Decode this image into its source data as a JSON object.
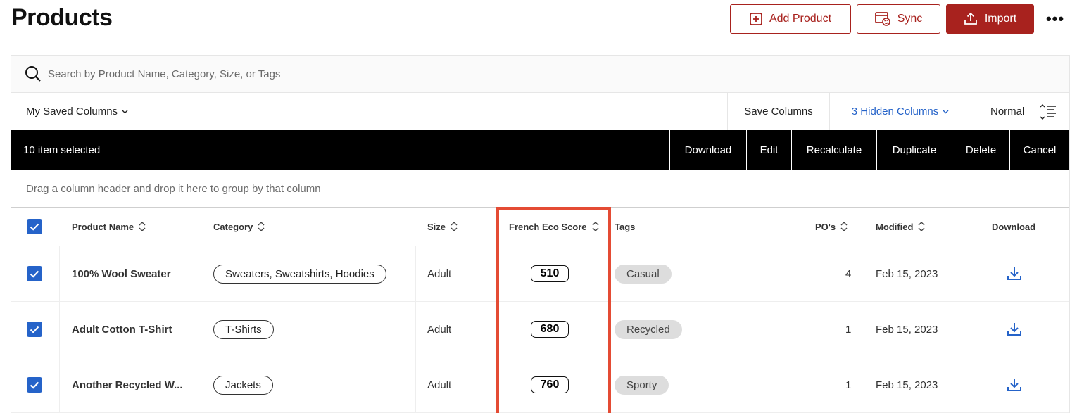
{
  "header": {
    "title": "Products",
    "add_product_label": "Add Product",
    "sync_label": "Sync",
    "import_label": "Import",
    "more_label": "•••"
  },
  "search": {
    "placeholder": "Search by Product Name, Category, Size, or Tags",
    "value": ""
  },
  "toolbar": {
    "saved_columns_label": "My Saved Columns",
    "save_columns_label": "Save Columns",
    "hidden_columns_label": "3 Hidden Columns",
    "density_label": "Normal"
  },
  "selection_bar": {
    "count_label": "10 item selected",
    "actions": [
      "Download",
      "Edit",
      "Recalculate",
      "Duplicate",
      "Delete",
      "Cancel"
    ]
  },
  "group_hint": "Drag a column header and drop it here to group by that column",
  "table": {
    "columns": [
      "Product Name",
      "Category",
      "Size",
      "French Eco Score",
      "Tags",
      "PO's",
      "Modified",
      "Download"
    ],
    "rows": [
      {
        "checked": true,
        "name": "100% Wool Sweater",
        "category": "Sweaters, Sweatshirts, Hoodies",
        "size": "Adult",
        "eco_score": "510",
        "tag": "Casual",
        "pos": "4",
        "modified": "Feb 15, 2023"
      },
      {
        "checked": true,
        "name": "Adult Cotton T-Shirt",
        "category": "T-Shirts",
        "size": "Adult",
        "eco_score": "680",
        "tag": "Recycled",
        "pos": "1",
        "modified": "Feb 15, 2023"
      },
      {
        "checked": true,
        "name": "Another Recycled W...",
        "category": "Jackets",
        "size": "Adult",
        "eco_score": "760",
        "tag": "Sporty",
        "pos": "1",
        "modified": "Feb 15, 2023"
      }
    ]
  },
  "colors": {
    "brand": "#a8221e",
    "link": "#2563c9",
    "highlight": "#e44b34",
    "selection_bar": "#000000"
  }
}
